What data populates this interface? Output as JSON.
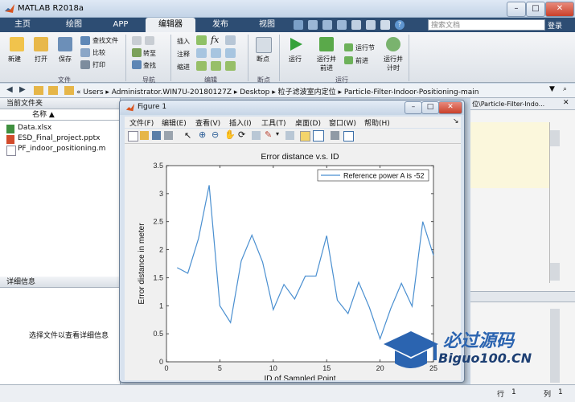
{
  "window": {
    "title": "MATLAB R2018a",
    "minimize": "–",
    "maximize": "□",
    "close": "✕"
  },
  "tabs": [
    "主页",
    "绘图",
    "APP",
    "编辑器",
    "发布",
    "视图"
  ],
  "search": {
    "placeholder": "搜索文档",
    "login": "登录"
  },
  "ribbon": {
    "file": {
      "new": "新建",
      "open": "打开",
      "save": "保存",
      "find_files": "查找文件",
      "compare": "比较",
      "print": "打印",
      "group": "文件"
    },
    "nav": {
      "goto": "转至",
      "find": "查找",
      "group": "导航"
    },
    "edit": {
      "insert": "插入",
      "comment": "注释",
      "indent": "缩进",
      "group": "编辑"
    },
    "breakpoints": {
      "label": "断点",
      "group": "断点"
    },
    "run": {
      "run": "运行",
      "run_advance": "运行并前进",
      "run_section": "运行节",
      "advance": "前进",
      "run_time": "运行并计时",
      "group": "运行"
    }
  },
  "address": {
    "path": "« Users ▸ Administrator.WIN7U-20180127Z ▸ Desktop ▸ 粒子滤波室内定位 ▸ Particle-Filter-Indoor-Positioning-main"
  },
  "left_pane": {
    "title": "当前文件夹",
    "column": "名称 ▲",
    "files": [
      "Data.xlsx",
      "ESD_Final_project.pptx",
      "PF_indoor_positioning.m"
    ],
    "detail_title": "详细信息",
    "detail_hint": "选择文件以查看详细信息"
  },
  "right_pane": {
    "crumb": "位\\Particle-Filter-Indo..."
  },
  "figure": {
    "title": "Figure 1",
    "menu": [
      "文件(F)",
      "编辑(E)",
      "查看(V)",
      "插入(I)",
      "工具(T)",
      "桌面(D)",
      "窗口(W)",
      "帮助(H)"
    ]
  },
  "status": {
    "row_label": "行",
    "row": "1",
    "col_label": "列",
    "col": "1"
  },
  "watermark": {
    "text": "必过源码",
    "url": "Biguo100.CN"
  },
  "colors": {
    "line": "#4a8fd0",
    "ribbon_tab_bg": "#2d4d73",
    "watermark": "#2b64b0"
  },
  "chart_data": {
    "type": "line",
    "title": "Error distance v.s. ID",
    "xlabel": "ID of Sampled Point",
    "ylabel": "Error distance in meter",
    "xlim": [
      0,
      25
    ],
    "ylim": [
      0,
      3.5
    ],
    "xticks": [
      0,
      5,
      10,
      15,
      20,
      25
    ],
    "yticks": [
      0,
      0.5,
      1,
      1.5,
      2,
      2.5,
      3,
      3.5
    ],
    "legend": "top-right",
    "series": [
      {
        "name": "Reference power A is -52",
        "x": [
          1,
          2,
          3,
          4,
          5,
          6,
          7,
          8,
          9,
          10,
          11,
          12,
          13,
          14,
          15,
          16,
          17,
          18,
          19,
          20,
          21,
          22,
          23,
          24,
          25
        ],
        "y": [
          1.68,
          1.58,
          2.2,
          3.15,
          1.0,
          0.7,
          1.8,
          2.26,
          1.78,
          0.93,
          1.38,
          1.12,
          1.53,
          1.53,
          2.25,
          1.1,
          0.86,
          1.42,
          0.97,
          0.41,
          0.95,
          1.4,
          0.99,
          2.5,
          1.9
        ]
      }
    ]
  }
}
